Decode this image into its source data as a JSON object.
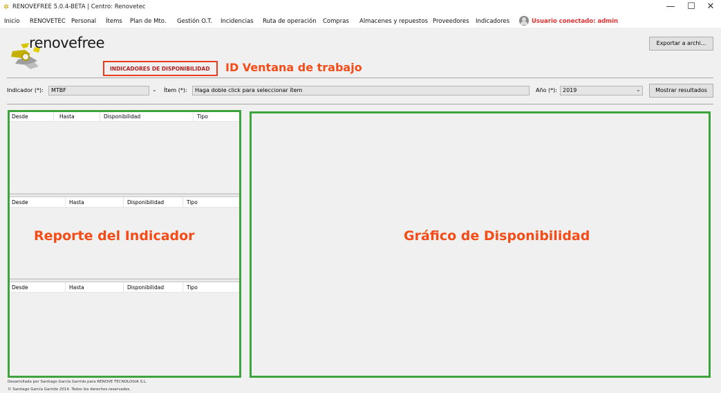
{
  "window": {
    "title": "RENOVEFREE 5.0.4-BETA | Centro: Renovetec",
    "controls": [
      "—",
      "☐",
      "✕"
    ]
  },
  "menu": {
    "items": [
      "Inicio",
      "RENOVETEC",
      "Personal",
      "Ítems",
      "Plan de Mto.",
      "Gestión O.T.",
      "Incidencias",
      "Ruta de operación",
      "Compras",
      "Almacenes y repuestos",
      "Proveedores",
      "Indicadores"
    ],
    "user_label": "Usuario conectado: admin"
  },
  "logo": {
    "text": "renovefree"
  },
  "header": {
    "window_id": "INDICADORES DE DISPONIBILIDAD",
    "annotation": "ID Ventana de trabajo",
    "export_label": "Exportar a archi..."
  },
  "filters": {
    "indicador_label": "Indicador (*):",
    "indicador_value": "MTBF",
    "item_label": "Ítem (*):",
    "item_value": "Haga doble click para seleccionar ítem",
    "anio_label": "Año (*):",
    "anio_value": "2019",
    "show_label": "Mostrar resultados"
  },
  "tables": [
    {
      "columns": [
        "Desde",
        "Hasta",
        "Disponibilidad",
        "Tipo"
      ]
    },
    {
      "columns": [
        "Desde",
        "Hasta",
        "Disponibilidad",
        "Tipo"
      ]
    },
    {
      "columns": [
        "Desde",
        "Hasta",
        "Disponibilidad",
        "Tipo"
      ]
    }
  ],
  "annotations": {
    "report": "Reporte del Indicador",
    "chart": "Gráfico de Disponibilidad"
  },
  "footer": {
    "line1": "Desarrollado por Santiago García Garrido para RENOVE TECNOLOGIA S.L.",
    "line2": "© Santiago García Garrido 2014. Todos los derechos reservados."
  },
  "colors": {
    "annotation": "#f34c18",
    "frame": "#3da33d",
    "user": "#e52e2e"
  }
}
